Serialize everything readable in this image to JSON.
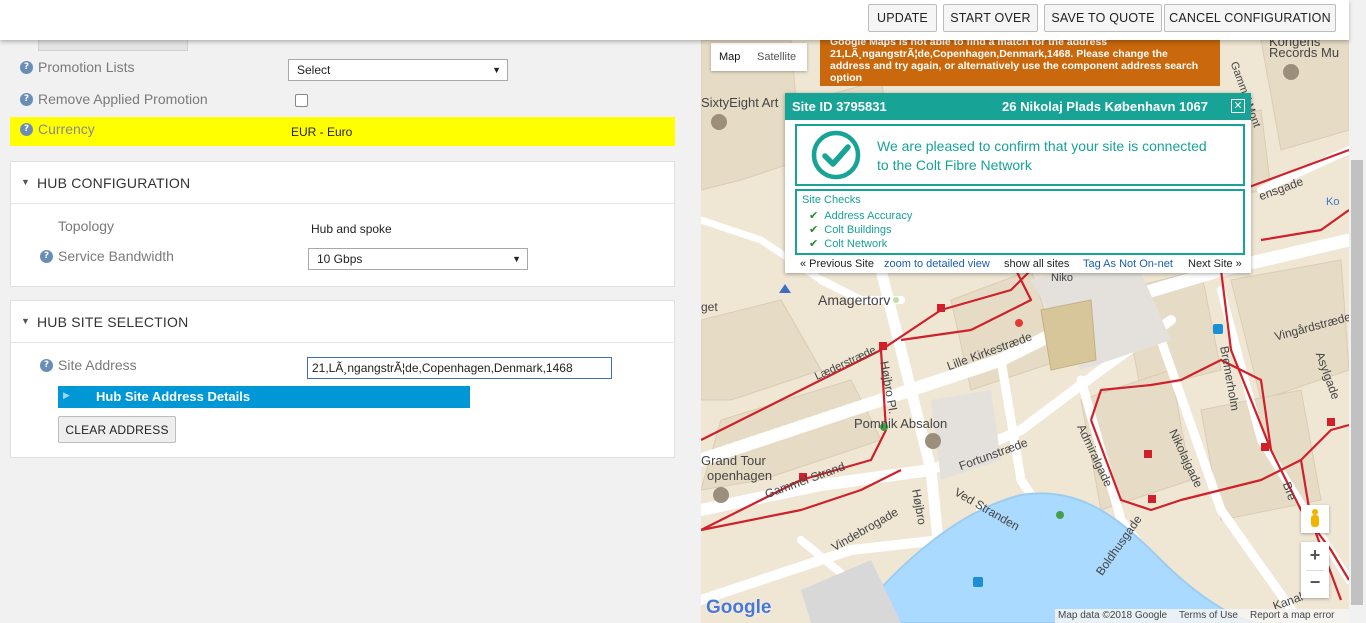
{
  "toolbar": {
    "update": "UPDATE",
    "start_over": "START OVER",
    "save_to_quote": "SAVE TO QUOTE",
    "cancel_configuration": "CANCEL CONFIGURATION"
  },
  "form": {
    "promotion_lists_label": "Promotion Lists",
    "promotion_lists_value": "Select",
    "remove_promotion_label": "Remove Applied Promotion",
    "currency_label": "Currency",
    "currency_value": "EUR - Euro"
  },
  "hub_config": {
    "title": "HUB CONFIGURATION",
    "topology_label": "Topology",
    "topology_value": "Hub and spoke",
    "bandwidth_label": "Service Bandwidth",
    "bandwidth_value": "10 Gbps"
  },
  "hub_site": {
    "title": "HUB SITE SELECTION",
    "address_label": "Site Address",
    "address_value": "21,LÃ¸ngangstrÃ¦de,Copenhagen,Denmark,1468",
    "details_label": "Hub Site Address Details",
    "clear_button": "CLEAR ADDRESS"
  },
  "map": {
    "type_map": "Map",
    "type_satellite": "Satellite",
    "warning": "Google Maps is not able to find a match for the address 21,LÃ¸ngangstrÃ¦de,Copenhagen,Denmark,1468. Please change the address and try again, or alternatively use the component address search option",
    "attribution": "Map data ©2018 Google",
    "terms": "Terms of Use",
    "report": "Report a map error",
    "google_logo": "Google",
    "labels": {
      "sixtyeight": "SixtyEight Art",
      "amagertorv": "Amagertorv",
      "lille": "Lille Kirkestræde",
      "pomnik": "Pomnik Absalon",
      "grand_tour": "Grand Tour",
      "copenhagen": "openhagen",
      "fortun": "Fortunstræde",
      "ved_stranden": "Ved Stranden",
      "gammel": "Gammel Strand",
      "hojbro": "Højbro Pl.",
      "laeder": "Læderstræde",
      "vindebrogade": "Vindebrogade",
      "boldhus": "Boldhusgade",
      "admiralgade": "Admiralgade",
      "nikolajgade": "Nikolajgade",
      "bremerholm": "Bremerholm",
      "vingaard": "Vingårdstræde",
      "asylgade": "Asylgade",
      "records": "Records Mu",
      "gammel_mont": "Gammel Mont",
      "ensgade": "ensgade",
      "niko": "Niko",
      "get": "get",
      "kongens": "Kongens",
      "hojbro2": "Højbro",
      "kanal": "Kanal",
      "ko": "Ko",
      "bre": "Bre"
    }
  },
  "site_popup": {
    "site_id": "Site ID 3795831",
    "address": "26 Nikolaj Plads København 1067",
    "message": "We are pleased to confirm that your site is connected to the Colt Fibre Network",
    "checks_title": "Site Checks",
    "checks": [
      "Address Accuracy",
      "Colt Buildings",
      "Colt Network"
    ],
    "prev": "« Previous Site",
    "zoom": "zoom to detailed view",
    "show_all": "show all sites",
    "tag": "Tag As Not On-net",
    "next": "Next Site »"
  },
  "colors": {
    "accent_teal": "#17a395",
    "currency_highlight": "#ffff00",
    "details_bar": "#0097d7",
    "warning_bg": "#c9680c",
    "network_line": "#d0202a"
  }
}
